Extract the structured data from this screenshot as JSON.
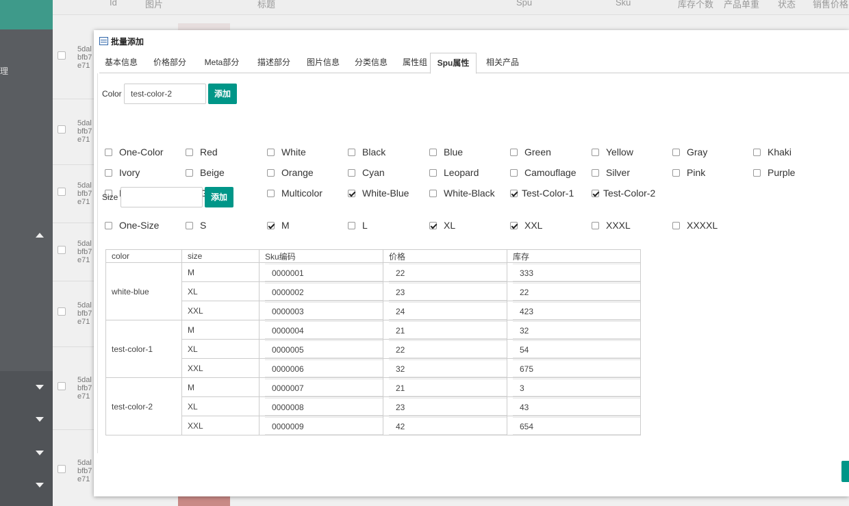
{
  "sidebar": {
    "glyph": "理"
  },
  "background": {
    "headers": [
      "Id",
      "图片",
      "标题",
      "Spu",
      "Sku",
      "库存个数",
      "产品单重",
      "状态",
      "销售价格"
    ],
    "rows": [
      {
        "line1": "5dal",
        "line2": "bfb7",
        "line3": "e71"
      },
      {
        "line1": "5dal",
        "line2": "bfb7",
        "line3": "e71"
      },
      {
        "line1": "5dal",
        "line2": "bfb7",
        "line3": "e71"
      },
      {
        "line1": "5dal",
        "line2": "bfb7",
        "line3": "e71"
      },
      {
        "line1": "5dal",
        "line2": "bfb7",
        "line3": "e71"
      },
      {
        "line1": "5dal",
        "line2": "bfb7",
        "line3": "e71"
      },
      {
        "line1": "5dal",
        "line2": "bfb7",
        "line3": "e71"
      }
    ]
  },
  "modal": {
    "title": "批量添加",
    "tabs": [
      "基本信息",
      "价格部分",
      "Meta部分",
      "描述部分",
      "图片信息",
      "分类信息",
      "属性组",
      "Spu属性",
      "相关产品"
    ],
    "active_tab": "Spu属性",
    "color_section": {
      "label": "Color",
      "input_value": "test-color-2",
      "add_label": "添加",
      "options": [
        {
          "label": "One-Color",
          "checked": false
        },
        {
          "label": "Red",
          "checked": false
        },
        {
          "label": "White",
          "checked": false
        },
        {
          "label": "Black",
          "checked": false
        },
        {
          "label": "Blue",
          "checked": false
        },
        {
          "label": "Green",
          "checked": false
        },
        {
          "label": "Yellow",
          "checked": false
        },
        {
          "label": "Gray",
          "checked": false
        },
        {
          "label": "Khaki",
          "checked": false
        },
        {
          "label": "Ivory",
          "checked": false
        },
        {
          "label": "Beige",
          "checked": false
        },
        {
          "label": "Orange",
          "checked": false
        },
        {
          "label": "Cyan",
          "checked": false
        },
        {
          "label": "Leopard",
          "checked": false
        },
        {
          "label": "Camouflage",
          "checked": false
        },
        {
          "label": "Silver",
          "checked": false
        },
        {
          "label": "Pink",
          "checked": false
        },
        {
          "label": "Purple",
          "checked": false
        },
        {
          "label": "Brown",
          "checked": false
        },
        {
          "label": "Golden",
          "checked": false
        },
        {
          "label": "Multicolor",
          "checked": false
        },
        {
          "label": "White-Blue",
          "checked": true
        },
        {
          "label": "White-Black",
          "checked": false
        },
        {
          "label": "Test-Color-1",
          "checked": true
        },
        {
          "label": "Test-Color-2",
          "checked": true
        }
      ]
    },
    "size_section": {
      "label": "Size",
      "input_value": "",
      "add_label": "添加",
      "options": [
        {
          "label": "One-Size",
          "checked": false
        },
        {
          "label": "S",
          "checked": false
        },
        {
          "label": "M",
          "checked": true
        },
        {
          "label": "L",
          "checked": false
        },
        {
          "label": "XL",
          "checked": true
        },
        {
          "label": "XXL",
          "checked": true
        },
        {
          "label": "XXXL",
          "checked": false
        },
        {
          "label": "XXXXL",
          "checked": false
        }
      ]
    },
    "sku_table": {
      "headers": [
        "color",
        "size",
        "Sku编码",
        "价格",
        "库存"
      ],
      "groups": [
        {
          "color": "white-blue",
          "rows": [
            {
              "size": "M",
              "sku": "0000001",
              "price": "22",
              "stock": "333"
            },
            {
              "size": "XL",
              "sku": "0000002",
              "price": "23",
              "stock": "22"
            },
            {
              "size": "XXL",
              "sku": "0000003",
              "price": "24",
              "stock": "423"
            }
          ]
        },
        {
          "color": "test-color-1",
          "rows": [
            {
              "size": "M",
              "sku": "0000004",
              "price": "21",
              "stock": "32"
            },
            {
              "size": "XL",
              "sku": "0000005",
              "price": "22",
              "stock": "54"
            },
            {
              "size": "XXL",
              "sku": "0000006",
              "price": "32",
              "stock": "675"
            }
          ]
        },
        {
          "color": "test-color-2",
          "rows": [
            {
              "size": "M",
              "sku": "0000007",
              "price": "21",
              "stock": "3"
            },
            {
              "size": "XL",
              "sku": "0000008",
              "price": "23",
              "stock": "43"
            },
            {
              "size": "XXL",
              "sku": "0000009",
              "price": "42",
              "stock": "654"
            }
          ]
        }
      ]
    }
  }
}
